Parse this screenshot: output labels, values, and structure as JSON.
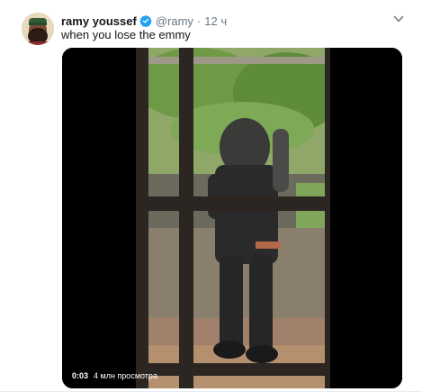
{
  "tweet": {
    "author": {
      "display_name": "ramy youssef",
      "handle": "@ramy",
      "verified": true
    },
    "time_separator": "·",
    "time": "12 ч",
    "text": "when you lose the emmy"
  },
  "media": {
    "type": "video",
    "elapsed": "0:03",
    "views": "4 млн просмотра"
  },
  "colors": {
    "verified_blue": "#1da1f2",
    "secondary_text": "#657786"
  }
}
